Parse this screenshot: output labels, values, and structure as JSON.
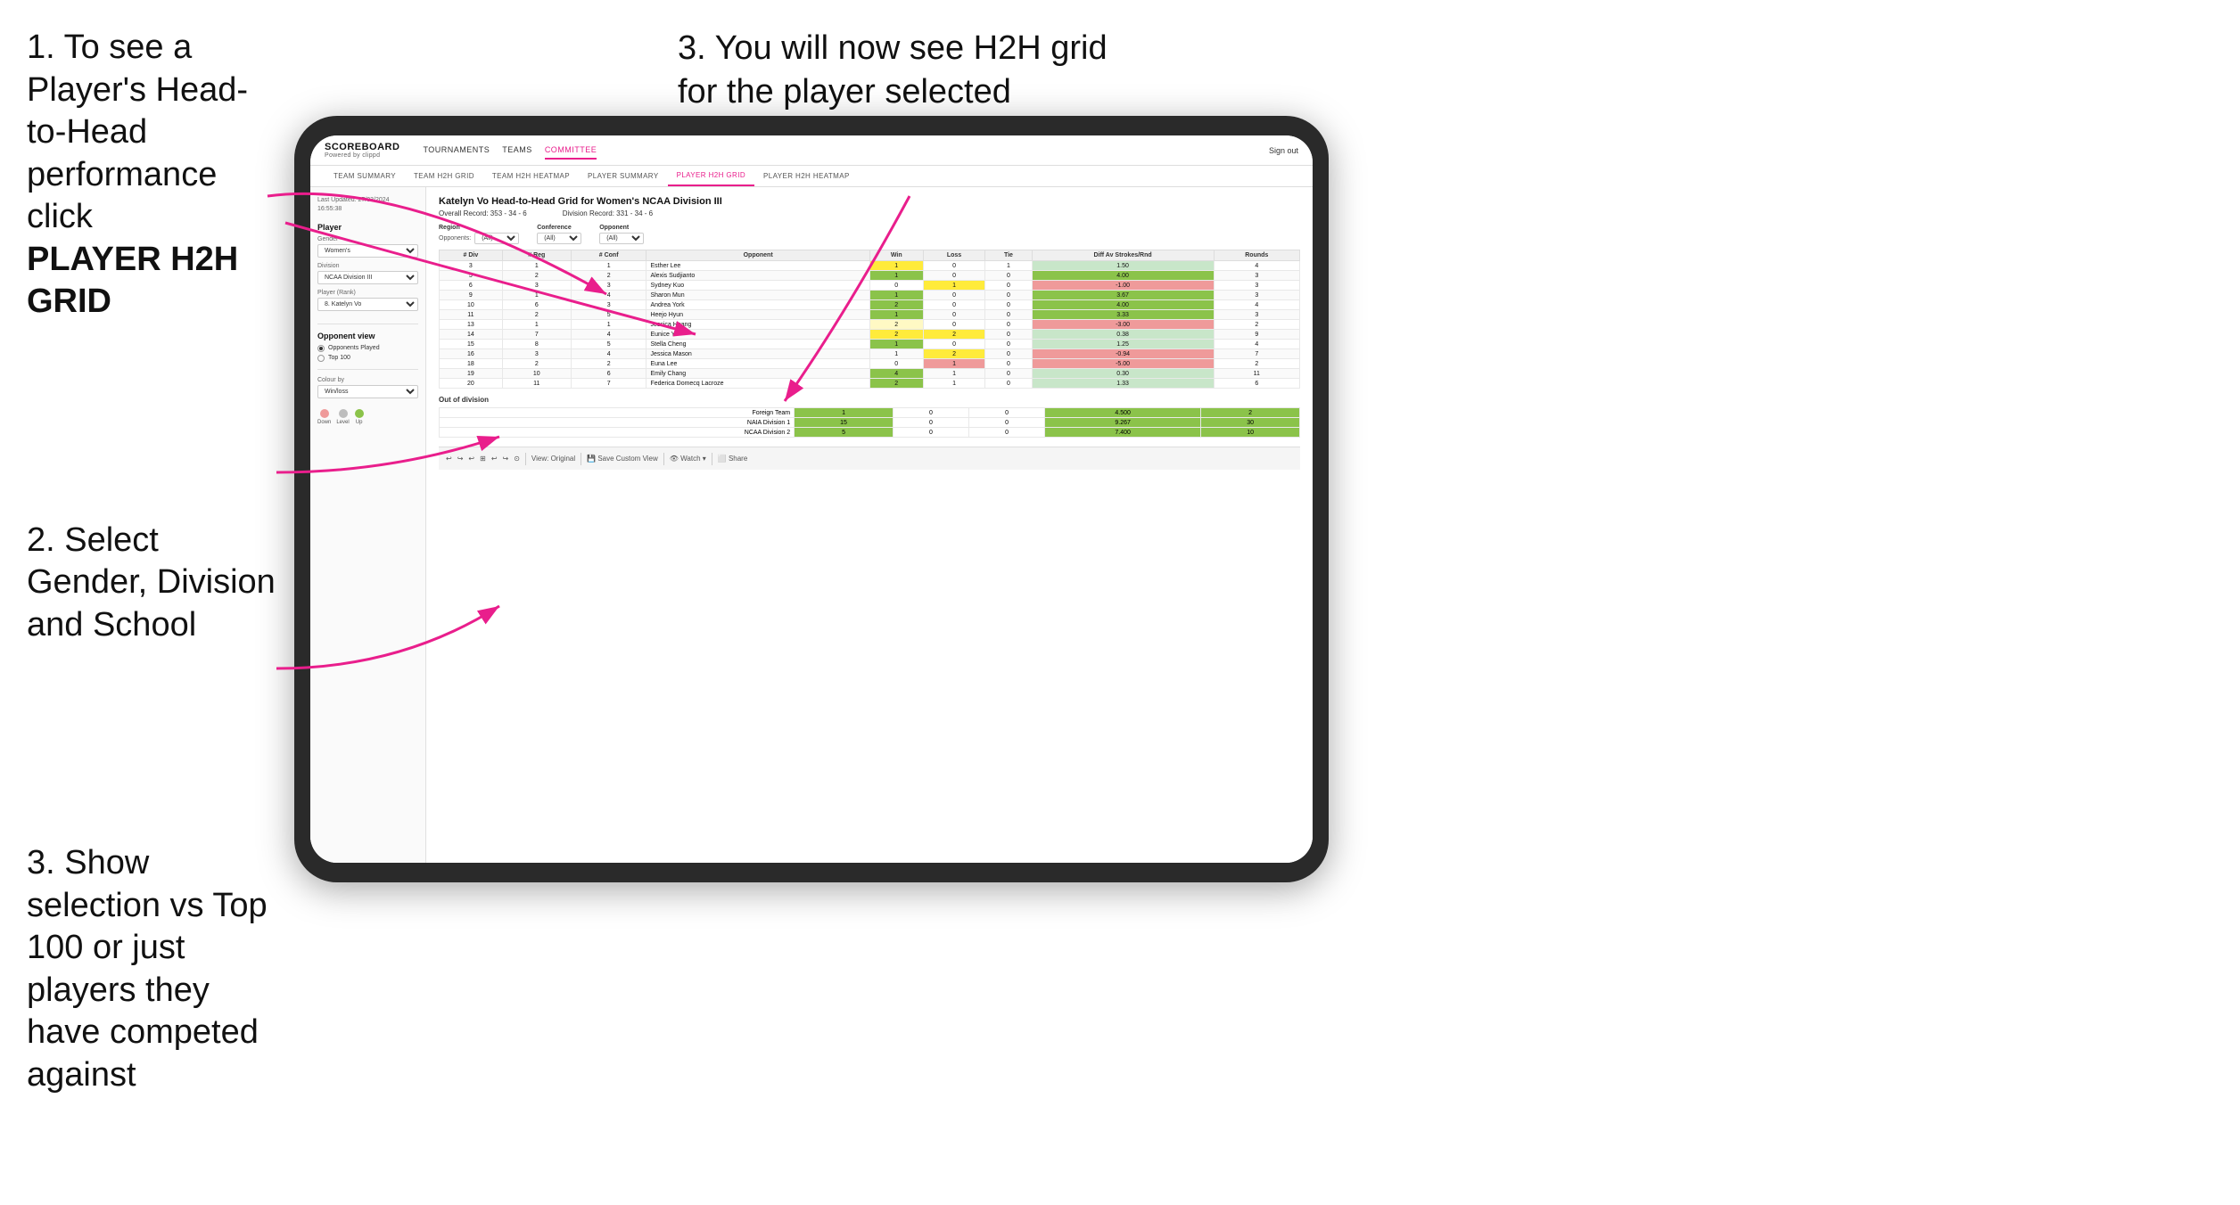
{
  "instructions": {
    "step1_text": "1. To see a Player's Head-to-Head performance click",
    "step1_bold": "PLAYER H2H GRID",
    "step2_text": "2. Select Gender, Division and School",
    "step3_left_text": "3. Show selection vs Top 100 or just players they have competed against",
    "step3_right_text": "3. You will now see H2H grid for the player selected"
  },
  "app": {
    "brand_name": "SCOREBOARD",
    "brand_sub": "Powered by clippd",
    "nav_items": [
      "TOURNAMENTS",
      "TEAMS",
      "COMMITTEE"
    ],
    "nav_sign_out": "Sign out",
    "sub_nav_items": [
      "TEAM SUMMARY",
      "TEAM H2H GRID",
      "TEAM H2H HEATMAP",
      "PLAYER SUMMARY",
      "PLAYER H2H GRID",
      "PLAYER H2H HEATMAP"
    ]
  },
  "left_panel": {
    "last_updated_label": "Last Updated: 27/03/2024",
    "last_updated_time": "16:55:38",
    "player_label": "Player",
    "gender_label": "Gender",
    "gender_value": "Women's",
    "division_label": "Division",
    "division_value": "NCAA Division III",
    "player_rank_label": "Player (Rank)",
    "player_rank_value": "8. Katelyn Vo",
    "opponent_view_label": "Opponent view",
    "radio_opponents": "Opponents Played",
    "radio_top100": "Top 100",
    "colour_by_label": "Colour by",
    "colour_by_value": "Win/loss",
    "colours": [
      {
        "label": "Down",
        "color": "#ef9a9a"
      },
      {
        "label": "Level",
        "color": "#bdbdbd"
      },
      {
        "label": "Up",
        "color": "#8bc34a"
      }
    ]
  },
  "grid": {
    "title": "Katelyn Vo Head-to-Head Grid for Women's NCAA Division III",
    "overall_record": "Overall Record: 353 - 34 - 6",
    "division_record": "Division Record: 331 - 34 - 6",
    "region_label": "Region",
    "conference_label": "Conference",
    "opponent_label": "Opponent",
    "opponents_label": "Opponents:",
    "opponents_value": "(All)",
    "col_div": "# Div",
    "col_reg": "# Reg",
    "col_conf": "# Conf",
    "col_opponent": "Opponent",
    "col_win": "Win",
    "col_loss": "Loss",
    "col_tie": "Tie",
    "col_diff": "Diff Av Strokes/Rnd",
    "col_rounds": "Rounds",
    "rows": [
      {
        "div": 3,
        "reg": 1,
        "conf": 1,
        "opponent": "Esther Lee",
        "win": 1,
        "loss": 0,
        "tie": 1,
        "diff": 1.5,
        "rounds": 4,
        "win_color": "yellow",
        "loss_color": ""
      },
      {
        "div": 5,
        "reg": 2,
        "conf": 2,
        "opponent": "Alexis Sudjianto",
        "win": 1,
        "loss": 0,
        "tie": 0,
        "diff": 4.0,
        "rounds": 3,
        "win_color": "green",
        "loss_color": ""
      },
      {
        "div": 6,
        "reg": 3,
        "conf": 3,
        "opponent": "Sydney Kuo",
        "win": 0,
        "loss": 1,
        "tie": 0,
        "diff": -1.0,
        "rounds": 3,
        "win_color": "",
        "loss_color": "yellow"
      },
      {
        "div": 9,
        "reg": 1,
        "conf": 4,
        "opponent": "Sharon Mun",
        "win": 1,
        "loss": 0,
        "tie": 0,
        "diff": 3.67,
        "rounds": 3,
        "win_color": "green",
        "loss_color": ""
      },
      {
        "div": 10,
        "reg": 6,
        "conf": 3,
        "opponent": "Andrea York",
        "win": 2,
        "loss": 0,
        "tie": 0,
        "diff": 4.0,
        "rounds": 4,
        "win_color": "green",
        "loss_color": ""
      },
      {
        "div": 11,
        "reg": 2,
        "conf": 5,
        "opponent": "Heejo Hyun",
        "win": 1,
        "loss": 0,
        "tie": 0,
        "diff": 3.33,
        "rounds": 3,
        "win_color": "green",
        "loss_color": ""
      },
      {
        "div": 13,
        "reg": 1,
        "conf": 1,
        "opponent": "Jessica Huang",
        "win": 2,
        "loss": 0,
        "tie": 0,
        "diff": -3.0,
        "rounds": 2,
        "win_color": "light-yellow",
        "loss_color": ""
      },
      {
        "div": 14,
        "reg": 7,
        "conf": 4,
        "opponent": "Eunice Yi",
        "win": 2,
        "loss": 2,
        "tie": 0,
        "diff": 0.38,
        "rounds": 9,
        "win_color": "yellow",
        "loss_color": "yellow"
      },
      {
        "div": 15,
        "reg": 8,
        "conf": 5,
        "opponent": "Stella Cheng",
        "win": 1,
        "loss": 0,
        "tie": 0,
        "diff": 1.25,
        "rounds": 4,
        "win_color": "green",
        "loss_color": ""
      },
      {
        "div": 16,
        "reg": 3,
        "conf": 4,
        "opponent": "Jessica Mason",
        "win": 1,
        "loss": 2,
        "tie": 0,
        "diff": -0.94,
        "rounds": 7,
        "win_color": "",
        "loss_color": "yellow"
      },
      {
        "div": 18,
        "reg": 2,
        "conf": 2,
        "opponent": "Euna Lee",
        "win": 0,
        "loss": 1,
        "tie": 0,
        "diff": -5.0,
        "rounds": 2,
        "win_color": "",
        "loss_color": "red"
      },
      {
        "div": 19,
        "reg": 10,
        "conf": 6,
        "opponent": "Emily Chang",
        "win": 4,
        "loss": 1,
        "tie": 0,
        "diff": 0.3,
        "rounds": 11,
        "win_color": "green",
        "loss_color": ""
      },
      {
        "div": 20,
        "reg": 11,
        "conf": 7,
        "opponent": "Federica Domecq Lacroze",
        "win": 2,
        "loss": 1,
        "tie": 0,
        "diff": 1.33,
        "rounds": 6,
        "win_color": "green",
        "loss_color": ""
      }
    ],
    "out_of_division_label": "Out of division",
    "ood_rows": [
      {
        "label": "Foreign Team",
        "win": 1,
        "loss": 0,
        "tie": 0,
        "diff": 4.5,
        "rounds": 2,
        "color": "green"
      },
      {
        "label": "NAIA Division 1",
        "win": 15,
        "loss": 0,
        "tie": 0,
        "diff": 9.267,
        "rounds": 30,
        "color": "green"
      },
      {
        "label": "NCAA Division 2",
        "win": 5,
        "loss": 0,
        "tie": 0,
        "diff": 7.4,
        "rounds": 10,
        "color": "green"
      }
    ]
  },
  "toolbar": {
    "items": [
      "↩",
      "↪",
      "↩",
      "⊞",
      "↩",
      "↪",
      "⊙",
      "View: Original",
      "Save Custom View",
      "👁 Watch ▾",
      "⬜",
      "Share"
    ]
  }
}
